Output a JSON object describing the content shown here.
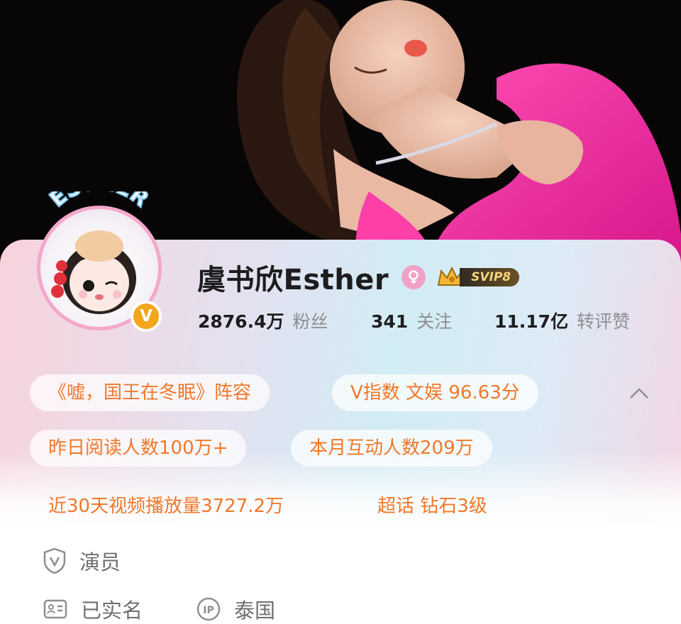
{
  "profile": {
    "name": "虞书欣Esther",
    "avatar_badge": "V",
    "avatar_label": "ESTHER",
    "gender_icon": "female-icon",
    "vip_badge": "SVIP8"
  },
  "stats": [
    {
      "value": "2876.4万",
      "label": "粉丝"
    },
    {
      "value": "341",
      "label": "关注"
    },
    {
      "value": "11.17亿",
      "label": "转评赞"
    }
  ],
  "chips": [
    {
      "text": "《嘘，国王在冬眠》阵容"
    },
    {
      "text": "V指数 文娱 96.63分"
    },
    {
      "text": "昨日阅读人数100万+"
    },
    {
      "text": "本月互动人数209万"
    },
    {
      "text": "近30天视频播放量3727.2万"
    },
    {
      "text": "超话 钻石3级"
    }
  ],
  "info": {
    "profession": "演员",
    "verified": "已实名",
    "ip_location": "泰国"
  },
  "colors": {
    "accent": "#f0782a",
    "gold_badge": "#f3a51b",
    "pink": "#f0a1c7",
    "text_dark": "#1d1d1f",
    "text_gray": "#8e8e93"
  }
}
